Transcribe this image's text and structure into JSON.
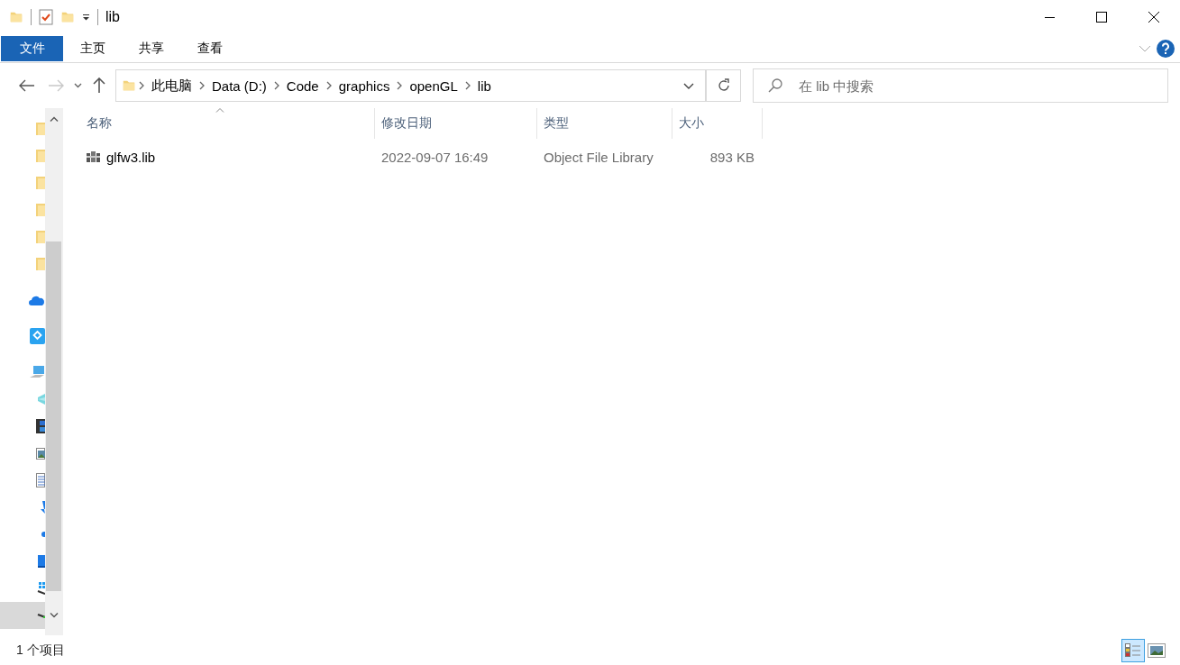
{
  "window": {
    "title": "lib",
    "quick_access": [
      {
        "kind": "folder"
      },
      {
        "kind": "properties"
      },
      {
        "kind": "folder"
      },
      {
        "kind": "dropdown"
      }
    ]
  },
  "ribbon": {
    "tabs": [
      {
        "label": "文件",
        "kind": "file"
      },
      {
        "label": "主页",
        "kind": "tab"
      },
      {
        "label": "共享",
        "kind": "tab"
      },
      {
        "label": "查看",
        "kind": "tab"
      }
    ]
  },
  "address": {
    "segments": [
      "此电脑",
      "Data (D:)",
      "Code",
      "graphics",
      "openGL",
      "lib"
    ],
    "search_placeholder": "在 lib 中搜索"
  },
  "navigation": [
    {
      "kind": "folder",
      "selected": false
    },
    {
      "kind": "folder",
      "selected": false
    },
    {
      "kind": "folder",
      "selected": false
    },
    {
      "kind": "folder",
      "selected": false
    },
    {
      "kind": "folder",
      "selected": false
    },
    {
      "kind": "folder",
      "selected": false
    },
    {
      "kind": "cloud",
      "selected": false
    },
    {
      "kind": "app",
      "selected": false
    },
    {
      "kind": "computer",
      "selected": false
    },
    {
      "kind": "objects",
      "selected": false
    },
    {
      "kind": "video",
      "selected": false
    },
    {
      "kind": "picture",
      "selected": false
    },
    {
      "kind": "document",
      "selected": false
    },
    {
      "kind": "download",
      "selected": false
    },
    {
      "kind": "music",
      "selected": false
    },
    {
      "kind": "desktop",
      "selected": false
    },
    {
      "kind": "windows-drive",
      "selected": false
    },
    {
      "kind": "drive",
      "selected": true
    }
  ],
  "columns": [
    {
      "label": "名称",
      "sorted": true
    },
    {
      "label": "修改日期",
      "sorted": false
    },
    {
      "label": "类型",
      "sorted": false
    },
    {
      "label": "大小",
      "sorted": false
    }
  ],
  "rows": [
    {
      "name": "glfw3.lib",
      "modified": "2022-09-07 16:49",
      "type": "Object File Library",
      "size": "893 KB"
    }
  ],
  "status_bar": {
    "item_count": "1 个项目",
    "views": [
      {
        "kind": "details",
        "selected": true
      },
      {
        "kind": "large-icons",
        "selected": false
      }
    ]
  }
}
